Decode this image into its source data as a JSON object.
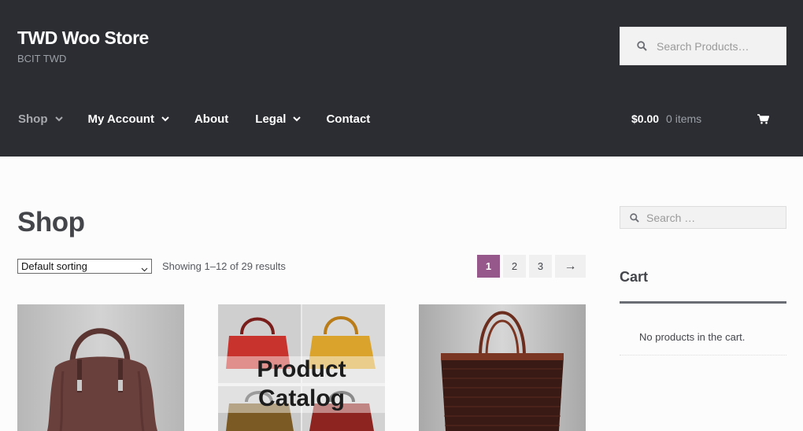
{
  "header": {
    "site_title": "TWD Woo Store",
    "site_description": "BCIT TWD",
    "search_placeholder": "Search Products…",
    "nav": [
      {
        "label": "Shop",
        "has_dropdown": true,
        "active": true
      },
      {
        "label": "My Account",
        "has_dropdown": true,
        "active": false
      },
      {
        "label": "About",
        "has_dropdown": false,
        "active": false
      },
      {
        "label": "Legal",
        "has_dropdown": true,
        "active": false
      },
      {
        "label": "Contact",
        "has_dropdown": false,
        "active": false
      }
    ],
    "cart": {
      "amount": "$0.00",
      "items": "0 items",
      "icon": "shopping-cart-icon"
    }
  },
  "main": {
    "title": "Shop",
    "sorting": {
      "selected": "Default sorting"
    },
    "result_count": "Showing 1–12 of 29 results",
    "pagination": {
      "pages": [
        "1",
        "2",
        "3"
      ],
      "current": "1",
      "next": "→"
    },
    "products": [
      {
        "image": "brown-suede-handbag"
      },
      {
        "image": "product-catalog-collage",
        "overlay_line1": "Product",
        "overlay_line2": "Catalog"
      },
      {
        "image": "woven-tote-bag"
      }
    ]
  },
  "sidebar": {
    "search_placeholder": "Search …",
    "cart_widget": {
      "title": "Cart",
      "empty_text": "No products in the cart."
    }
  },
  "colors": {
    "header_bg": "#2c2d33",
    "accent": "#96588a",
    "page_bg": "#fcfcfc",
    "text": "#43454b"
  }
}
